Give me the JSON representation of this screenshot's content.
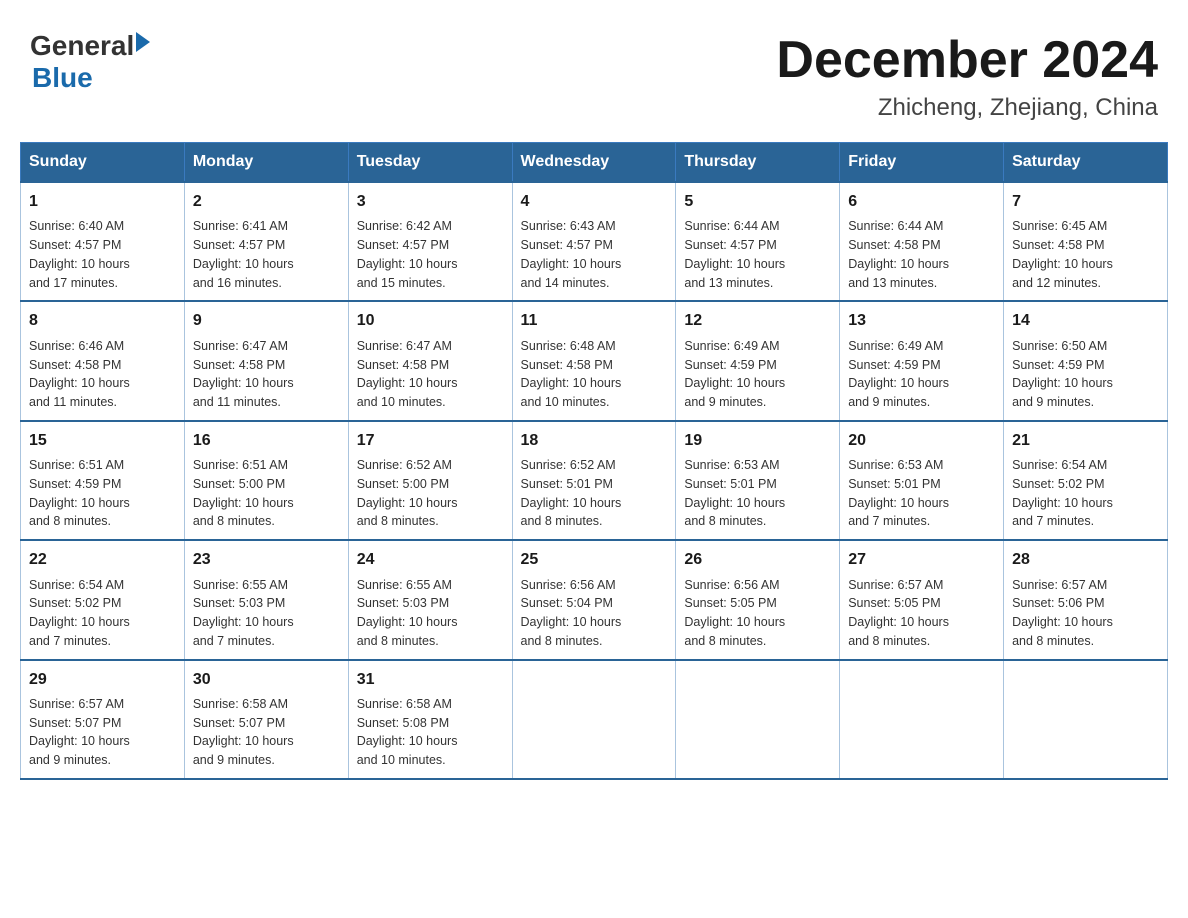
{
  "header": {
    "logo_general": "General",
    "logo_blue": "Blue",
    "title": "December 2024",
    "subtitle": "Zhicheng, Zhejiang, China"
  },
  "weekdays": [
    "Sunday",
    "Monday",
    "Tuesday",
    "Wednesday",
    "Thursday",
    "Friday",
    "Saturday"
  ],
  "weeks": [
    [
      {
        "day": "1",
        "sunrise": "6:40 AM",
        "sunset": "4:57 PM",
        "daylight": "10 hours and 17 minutes."
      },
      {
        "day": "2",
        "sunrise": "6:41 AM",
        "sunset": "4:57 PM",
        "daylight": "10 hours and 16 minutes."
      },
      {
        "day": "3",
        "sunrise": "6:42 AM",
        "sunset": "4:57 PM",
        "daylight": "10 hours and 15 minutes."
      },
      {
        "day": "4",
        "sunrise": "6:43 AM",
        "sunset": "4:57 PM",
        "daylight": "10 hours and 14 minutes."
      },
      {
        "day": "5",
        "sunrise": "6:44 AM",
        "sunset": "4:57 PM",
        "daylight": "10 hours and 13 minutes."
      },
      {
        "day": "6",
        "sunrise": "6:44 AM",
        "sunset": "4:58 PM",
        "daylight": "10 hours and 13 minutes."
      },
      {
        "day": "7",
        "sunrise": "6:45 AM",
        "sunset": "4:58 PM",
        "daylight": "10 hours and 12 minutes."
      }
    ],
    [
      {
        "day": "8",
        "sunrise": "6:46 AM",
        "sunset": "4:58 PM",
        "daylight": "10 hours and 11 minutes."
      },
      {
        "day": "9",
        "sunrise": "6:47 AM",
        "sunset": "4:58 PM",
        "daylight": "10 hours and 11 minutes."
      },
      {
        "day": "10",
        "sunrise": "6:47 AM",
        "sunset": "4:58 PM",
        "daylight": "10 hours and 10 minutes."
      },
      {
        "day": "11",
        "sunrise": "6:48 AM",
        "sunset": "4:58 PM",
        "daylight": "10 hours and 10 minutes."
      },
      {
        "day": "12",
        "sunrise": "6:49 AM",
        "sunset": "4:59 PM",
        "daylight": "10 hours and 9 minutes."
      },
      {
        "day": "13",
        "sunrise": "6:49 AM",
        "sunset": "4:59 PM",
        "daylight": "10 hours and 9 minutes."
      },
      {
        "day": "14",
        "sunrise": "6:50 AM",
        "sunset": "4:59 PM",
        "daylight": "10 hours and 9 minutes."
      }
    ],
    [
      {
        "day": "15",
        "sunrise": "6:51 AM",
        "sunset": "4:59 PM",
        "daylight": "10 hours and 8 minutes."
      },
      {
        "day": "16",
        "sunrise": "6:51 AM",
        "sunset": "5:00 PM",
        "daylight": "10 hours and 8 minutes."
      },
      {
        "day": "17",
        "sunrise": "6:52 AM",
        "sunset": "5:00 PM",
        "daylight": "10 hours and 8 minutes."
      },
      {
        "day": "18",
        "sunrise": "6:52 AM",
        "sunset": "5:01 PM",
        "daylight": "10 hours and 8 minutes."
      },
      {
        "day": "19",
        "sunrise": "6:53 AM",
        "sunset": "5:01 PM",
        "daylight": "10 hours and 8 minutes."
      },
      {
        "day": "20",
        "sunrise": "6:53 AM",
        "sunset": "5:01 PM",
        "daylight": "10 hours and 7 minutes."
      },
      {
        "day": "21",
        "sunrise": "6:54 AM",
        "sunset": "5:02 PM",
        "daylight": "10 hours and 7 minutes."
      }
    ],
    [
      {
        "day": "22",
        "sunrise": "6:54 AM",
        "sunset": "5:02 PM",
        "daylight": "10 hours and 7 minutes."
      },
      {
        "day": "23",
        "sunrise": "6:55 AM",
        "sunset": "5:03 PM",
        "daylight": "10 hours and 7 minutes."
      },
      {
        "day": "24",
        "sunrise": "6:55 AM",
        "sunset": "5:03 PM",
        "daylight": "10 hours and 8 minutes."
      },
      {
        "day": "25",
        "sunrise": "6:56 AM",
        "sunset": "5:04 PM",
        "daylight": "10 hours and 8 minutes."
      },
      {
        "day": "26",
        "sunrise": "6:56 AM",
        "sunset": "5:05 PM",
        "daylight": "10 hours and 8 minutes."
      },
      {
        "day": "27",
        "sunrise": "6:57 AM",
        "sunset": "5:05 PM",
        "daylight": "10 hours and 8 minutes."
      },
      {
        "day": "28",
        "sunrise": "6:57 AM",
        "sunset": "5:06 PM",
        "daylight": "10 hours and 8 minutes."
      }
    ],
    [
      {
        "day": "29",
        "sunrise": "6:57 AM",
        "sunset": "5:07 PM",
        "daylight": "10 hours and 9 minutes."
      },
      {
        "day": "30",
        "sunrise": "6:58 AM",
        "sunset": "5:07 PM",
        "daylight": "10 hours and 9 minutes."
      },
      {
        "day": "31",
        "sunrise": "6:58 AM",
        "sunset": "5:08 PM",
        "daylight": "10 hours and 10 minutes."
      },
      null,
      null,
      null,
      null
    ]
  ],
  "labels": {
    "sunrise": "Sunrise:",
    "sunset": "Sunset:",
    "daylight": "Daylight:"
  }
}
